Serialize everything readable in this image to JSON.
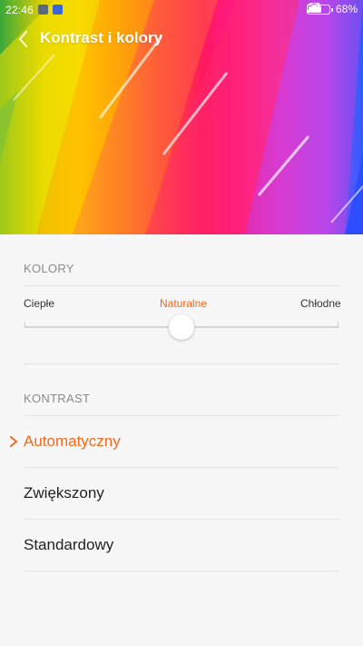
{
  "status_bar": {
    "time": "22:46",
    "battery_percent": "68%",
    "battery_level": 0.68
  },
  "header": {
    "title": "Kontrast i kolory"
  },
  "colors_section": {
    "label": "KOLORY",
    "scale": {
      "left": "Ciepłe",
      "center": "Naturalne",
      "right": "Chłodne",
      "value": 0.5
    }
  },
  "contrast_section": {
    "label": "KONTRAST",
    "options": [
      {
        "label": "Automatyczny",
        "selected": true
      },
      {
        "label": "Zwiększony",
        "selected": false
      },
      {
        "label": "Standardowy",
        "selected": false
      }
    ]
  },
  "theme": {
    "accent": "#f26a1b",
    "background": "#f7f7f7"
  }
}
